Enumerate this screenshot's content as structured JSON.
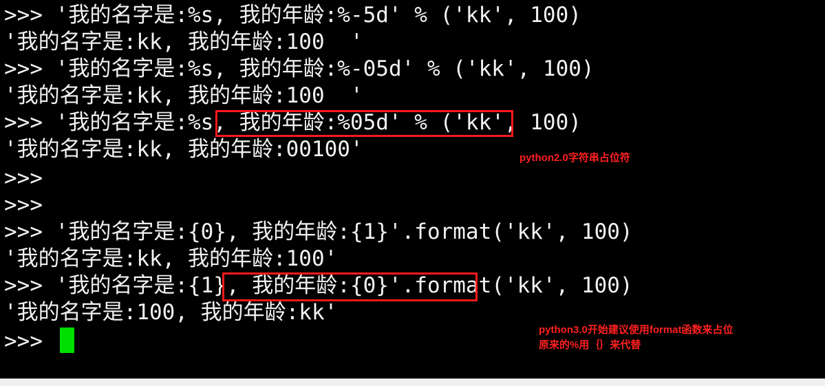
{
  "terminal": {
    "lines": [
      ">>> '我的名字是:%s, 我的年龄:%-5d' % ('kk', 100)",
      "'我的名字是:kk, 我的年龄:100  '",
      ">>> '我的名字是:%s, 我的年龄:%-05d' % ('kk', 100)",
      "'我的名字是:kk, 我的年龄:100  '",
      ">>> '我的名字是:%s, 我的年龄:%05d' % ('kk', 100)",
      "'我的名字是:kk, 我的年龄:00100'",
      ">>>",
      ">>>",
      ">>> '我的名字是:{0}, 我的年龄:{1}'.format('kk', 100)",
      "'我的名字是:kk, 我的年龄:100'",
      ">>> '我的名字是:{1}, 我的年龄:{0}'.format('kk', 100)",
      "'我的名字是:100, 我的年龄:kk'",
      ">>> "
    ]
  },
  "annotations": {
    "note_py2": "python2.0字符串占位符",
    "note_py3_line1": "python3.0开始建议使用format函数来占位",
    "note_py3_line2": "原来的%用｛｝来代替"
  },
  "colors": {
    "background": "#000000",
    "text": "#f2f2f2",
    "annotation": "#ff2020",
    "cursor": "#00e000"
  }
}
